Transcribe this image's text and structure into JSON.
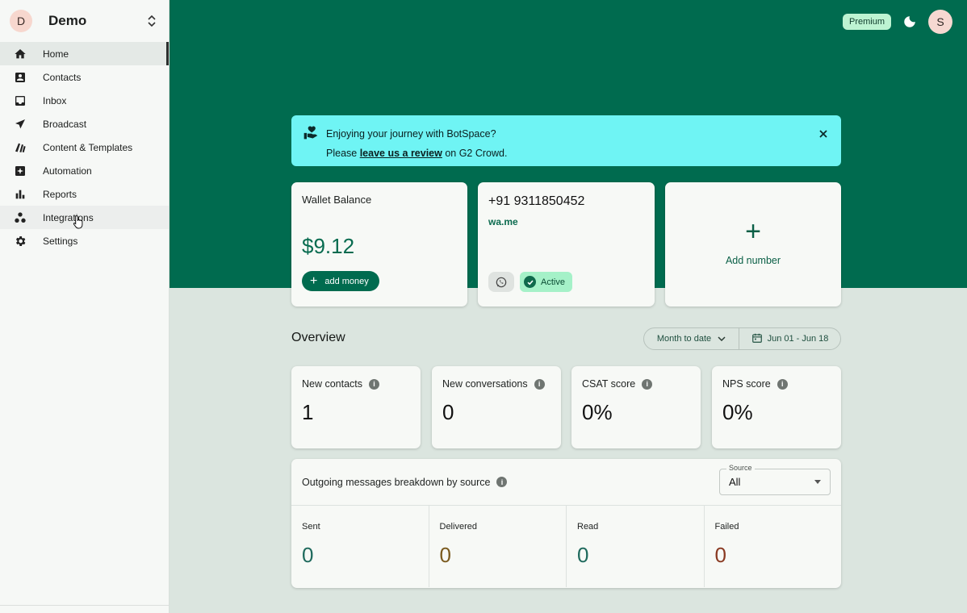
{
  "workspace": {
    "initial": "D",
    "name": "Demo"
  },
  "sidebar": {
    "items": [
      {
        "label": "Home",
        "icon": "home-icon"
      },
      {
        "label": "Contacts",
        "icon": "contacts-icon"
      },
      {
        "label": "Inbox",
        "icon": "inbox-icon"
      },
      {
        "label": "Broadcast",
        "icon": "send-icon"
      },
      {
        "label": "Content & Templates",
        "icon": "templates-icon"
      },
      {
        "label": "Automation",
        "icon": "automation-icon"
      },
      {
        "label": "Reports",
        "icon": "bar-chart-icon"
      },
      {
        "label": "Integrations",
        "icon": "integrations-icon"
      },
      {
        "label": "Settings",
        "icon": "gear-icon"
      }
    ]
  },
  "topbar": {
    "plan_badge": "Premium",
    "user_initial": "S"
  },
  "banner": {
    "title": "Enjoying your journey with BotSpace?",
    "prefix": "Please ",
    "link": "leave us a review",
    "suffix": " on G2 Crowd."
  },
  "wallet": {
    "title": "Wallet Balance",
    "amount": "$9.12",
    "button": "add money"
  },
  "phone": {
    "number": "+91 9311850452",
    "link": "wa.me",
    "status": "Active"
  },
  "add_number": {
    "label": "Add number",
    "symbol": "+"
  },
  "overview": {
    "title": "Overview",
    "range_select": "Month to date",
    "date_range": "Jun 01 - Jun 18"
  },
  "stats": [
    {
      "title": "New contacts",
      "value": "1"
    },
    {
      "title": "New conversations",
      "value": "0"
    },
    {
      "title": "CSAT score",
      "value": "0%"
    },
    {
      "title": "NPS score",
      "value": "0%"
    }
  ],
  "breakdown": {
    "title": "Outgoing messages breakdown by source",
    "source_label": "Source",
    "source_value": "All",
    "columns": [
      {
        "label": "Sent",
        "value": "0",
        "color": "#1f6a5d"
      },
      {
        "label": "Delivered",
        "value": "0",
        "color": "#7a5a1e"
      },
      {
        "label": "Read",
        "value": "0",
        "color": "#1f6a5d"
      },
      {
        "label": "Failed",
        "value": "0",
        "color": "#8a3a22"
      }
    ]
  },
  "colors": {
    "brand": "#006b4f",
    "banner": "#6ff4f4",
    "background": "#dbe5df"
  }
}
